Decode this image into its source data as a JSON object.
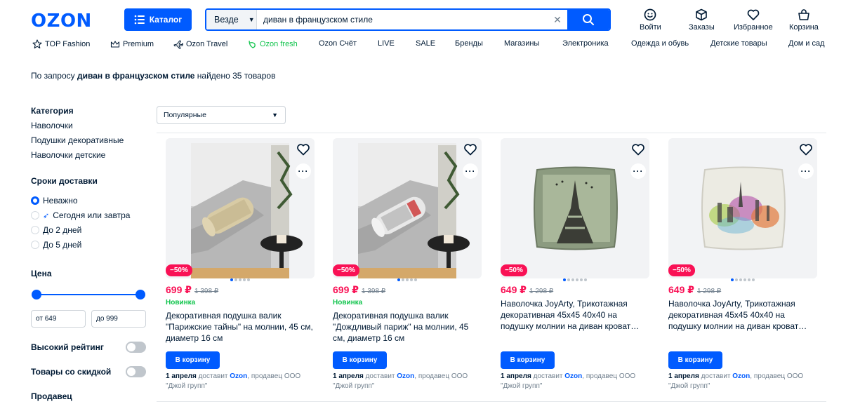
{
  "header": {
    "logo": "OZON",
    "catalog_label": "Каталог",
    "search_scope": "Везде",
    "search_value": "диван в французском стиле",
    "icons": [
      {
        "name": "login-icon",
        "label": "Войти"
      },
      {
        "name": "orders-icon",
        "label": "Заказы"
      },
      {
        "name": "favorites-icon",
        "label": "Избранное"
      },
      {
        "name": "cart-icon",
        "label": "Корзина"
      }
    ]
  },
  "nav": [
    "TOP Fashion",
    "Premium",
    "Ozon Travel",
    "Ozon fresh",
    "Ozon Счёт",
    "LIVE",
    "SALE",
    "Бренды",
    "Магазины",
    "Электроника",
    "Одежда и обувь",
    "Детские товары",
    "Дом и сад"
  ],
  "summary": {
    "prefix": "По запросу ",
    "query": "диван в французском стиле",
    "suffix": " найдено 35 товаров"
  },
  "sidebar": {
    "category_title": "Категория",
    "categories": [
      "Наволочки",
      "Подушки декоративные",
      "Наволочки детские"
    ],
    "delivery_title": "Сроки доставки",
    "delivery_options": [
      "Неважно",
      "Сегодня или завтра",
      "До 2 дней",
      "До 5 дней"
    ],
    "price_title": "Цена",
    "price_from": "от 649",
    "price_to": "до 999",
    "high_rating": "Высокий рейтинг",
    "discount": "Товары со скидкой",
    "seller_title": "Продавец"
  },
  "sort": {
    "selected": "Популярные"
  },
  "colors": {
    "accent": "#005bff",
    "sale": "#f91155",
    "new": "#10c44c"
  },
  "products": [
    {
      "discount": "−50%",
      "price": "699 ₽",
      "old_price": "1 398 ₽",
      "tag": "Новинка",
      "title": "Декоративная подушка валик \"Парижские тайны\" на молнии, 45 см, диаметр 16 см",
      "button": "В корзину",
      "delivery_date": "1 апреля",
      "delivery_mid": " доставит ",
      "courier": "Ozon",
      "seller": ", продавец ООО \"Джой групп\""
    },
    {
      "discount": "−50%",
      "price": "699 ₽",
      "old_price": "1 398 ₽",
      "tag": "Новинка",
      "title": "Декоративная подушка валик \"Дождливый париж\" на молнии, 45 см, диаметр 16 см",
      "button": "В корзину",
      "delivery_date": "1 апреля",
      "delivery_mid": " доставит ",
      "courier": "Ozon",
      "seller": ", продавец ООО \"Джой групп\""
    },
    {
      "discount": "−50%",
      "price": "649 ₽",
      "old_price": "1 298 ₽",
      "tag": "",
      "title": "Наволочка JoyArty, Трикотажная декоративная 45х45 40х40 на подушку молнии на диван кроват…",
      "button": "В корзину",
      "delivery_date": "1 апреля",
      "delivery_mid": " доставит ",
      "courier": "Ozon",
      "seller": ", продавец ООО \"Джой групп\""
    },
    {
      "discount": "−50%",
      "price": "649 ₽",
      "old_price": "1 298 ₽",
      "tag": "",
      "title": "Наволочка JoyArty, Трикотажная декоративная 45х45 40х40 на подушку молнии на диван кроват…",
      "button": "В корзину",
      "delivery_date": "1 апреля",
      "delivery_mid": " доставит ",
      "courier": "Ozon",
      "seller": ", продавец ООО \"Джой групп\""
    }
  ]
}
